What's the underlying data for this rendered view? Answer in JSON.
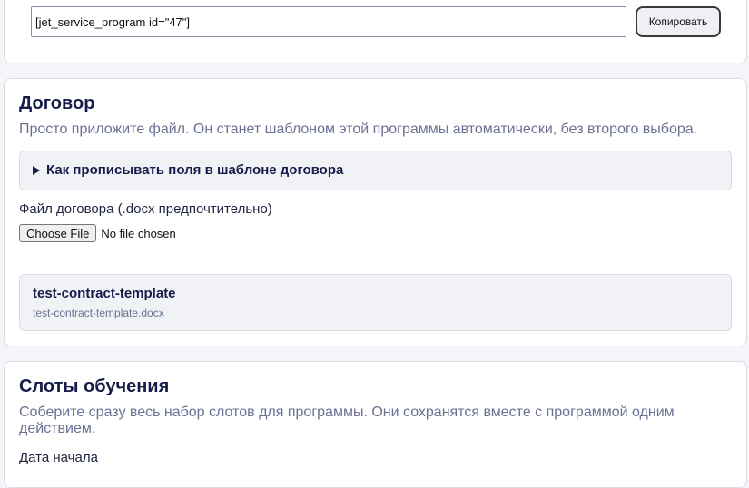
{
  "shortcode": {
    "value": "[jet_service_program id=\"47\"]",
    "copy_label": "Копировать"
  },
  "contract": {
    "title": "Договор",
    "description": "Просто приложите файл. Он станет шаблоном этой программы автоматически, без второго выбора.",
    "details_summary": "Как прописывать поля в шаблоне договора",
    "file_label": "Файл договора (.docx предпочтительно)",
    "choose_file_label": "Choose File",
    "no_file_text": "No file chosen",
    "template": {
      "name": "test-contract-template",
      "filename": "test-contract-template.docx"
    }
  },
  "slots": {
    "title": "Слоты обучения",
    "description": "Соберите сразу весь набор слотов для программы. Они сохранятся вместе с программой одним действием.",
    "start_date_label": "Дата начала"
  },
  "colors": {
    "title": "#171c4a",
    "muted": "#6b7194",
    "panel": "#f1f2f6",
    "border": "#d9dce6"
  }
}
